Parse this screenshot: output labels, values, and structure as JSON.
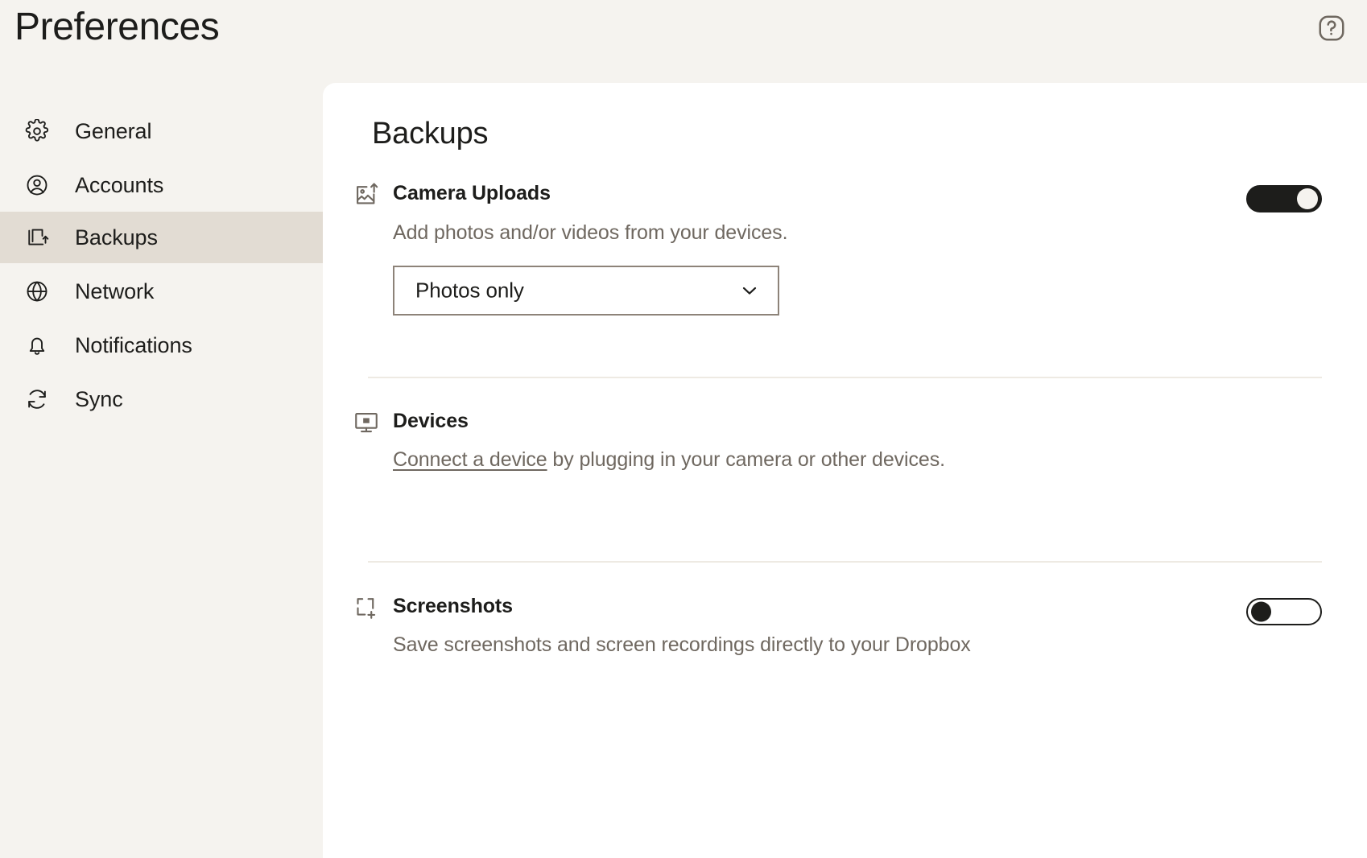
{
  "window": {
    "title": "Preferences",
    "background_color": "#f5f3ef",
    "card_color": "#ffffff",
    "accent_active_color": "#e2dcd3",
    "muted_text_color": "#6f6860",
    "text_color": "#1d1d1b"
  },
  "header": {
    "title": "Preferences",
    "help_icon": "help-circle-icon"
  },
  "sidebar": {
    "items": [
      {
        "label": "General",
        "icon": "gear-icon",
        "active": false
      },
      {
        "label": "Accounts",
        "icon": "user-circle-icon",
        "active": false
      },
      {
        "label": "Backups",
        "icon": "backup-export-icon",
        "active": true
      },
      {
        "label": "Network",
        "icon": "globe-icon",
        "active": false
      },
      {
        "label": "Notifications",
        "icon": "bell-icon",
        "active": false
      },
      {
        "label": "Sync",
        "icon": "sync-refresh-icon",
        "active": false
      }
    ]
  },
  "main": {
    "title": "Backups",
    "sections": [
      {
        "id": "camera-uploads",
        "icon": "image-upload-icon",
        "title": "Camera Uploads",
        "description": "Add photos and/or videos from your devices.",
        "toggle": {
          "state": "on",
          "label": "Camera Uploads toggle"
        },
        "select": {
          "value": "Photos only",
          "chevron_icon": "chevron-down-icon",
          "options": [
            "Photos only"
          ]
        }
      },
      {
        "id": "devices",
        "icon": "monitor-icon",
        "title": "Devices",
        "description_link": "Connect a device",
        "description_rest": " by plugging in your camera or other devices."
      },
      {
        "id": "screenshots",
        "icon": "screenshot-add-icon",
        "title": "Screenshots",
        "description": "Save screenshots and screen recordings directly to your Dropbox",
        "toggle": {
          "state": "off",
          "label": "Screenshots toggle"
        }
      }
    ]
  }
}
